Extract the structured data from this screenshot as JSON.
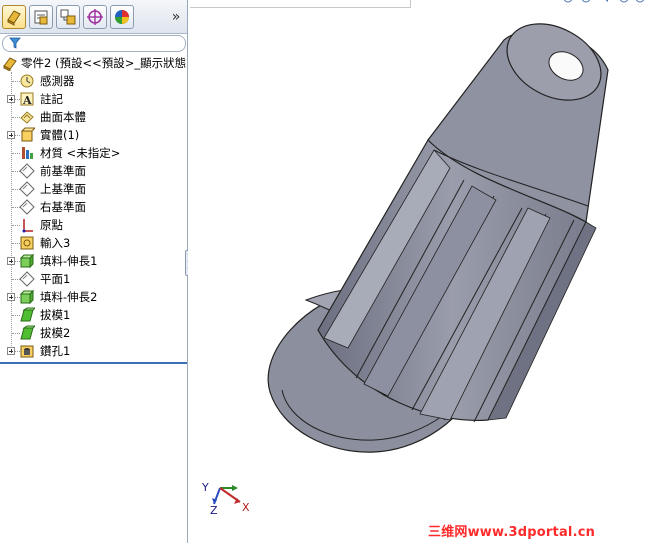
{
  "tabs": [
    {
      "name": "feature-manager-icon"
    },
    {
      "name": "property-manager-icon"
    },
    {
      "name": "configuration-manager-icon"
    },
    {
      "name": "dimxpert-icon"
    },
    {
      "name": "display-manager-icon"
    }
  ],
  "tab_more": "»",
  "tree": {
    "root": "零件2 (預設<<預設>_顯示狀態",
    "items": [
      {
        "label": "感測器",
        "icon": "sensor-icon",
        "expandable": false
      },
      {
        "label": "註記",
        "icon": "annotation-icon",
        "expandable": true
      },
      {
        "label": "曲面本體",
        "icon": "surface-body-icon",
        "expandable": false
      },
      {
        "label": "實體(1)",
        "icon": "solid-body-icon",
        "expandable": true
      },
      {
        "label": "材質 <未指定>",
        "icon": "material-icon",
        "expandable": false
      },
      {
        "label": "前基準面",
        "icon": "plane-icon",
        "expandable": false
      },
      {
        "label": "上基準面",
        "icon": "plane-icon",
        "expandable": false
      },
      {
        "label": "右基準面",
        "icon": "plane-icon",
        "expandable": false
      },
      {
        "label": "原點",
        "icon": "origin-icon",
        "expandable": false
      },
      {
        "label": "輸入3",
        "icon": "import-icon",
        "expandable": false
      },
      {
        "label": "填料-伸長1",
        "icon": "extrude-icon",
        "expandable": true
      },
      {
        "label": "平面1",
        "icon": "plane-icon",
        "expandable": false
      },
      {
        "label": "填料-伸長2",
        "icon": "extrude-icon",
        "expandable": true
      },
      {
        "label": "拔模1",
        "icon": "draft-icon",
        "expandable": false
      },
      {
        "label": "拔模2",
        "icon": "draft-icon",
        "expandable": false
      },
      {
        "label": "鑽孔1",
        "icon": "hole-icon",
        "expandable": true
      }
    ]
  },
  "triad": {
    "x": "X",
    "y": "Y",
    "z": "Z"
  },
  "watermark": "三维网www.3dportal.cn",
  "colors": {
    "part": "#8a8d9c",
    "accent": "#3d6fb6",
    "watermark": "#ff2b2b"
  }
}
